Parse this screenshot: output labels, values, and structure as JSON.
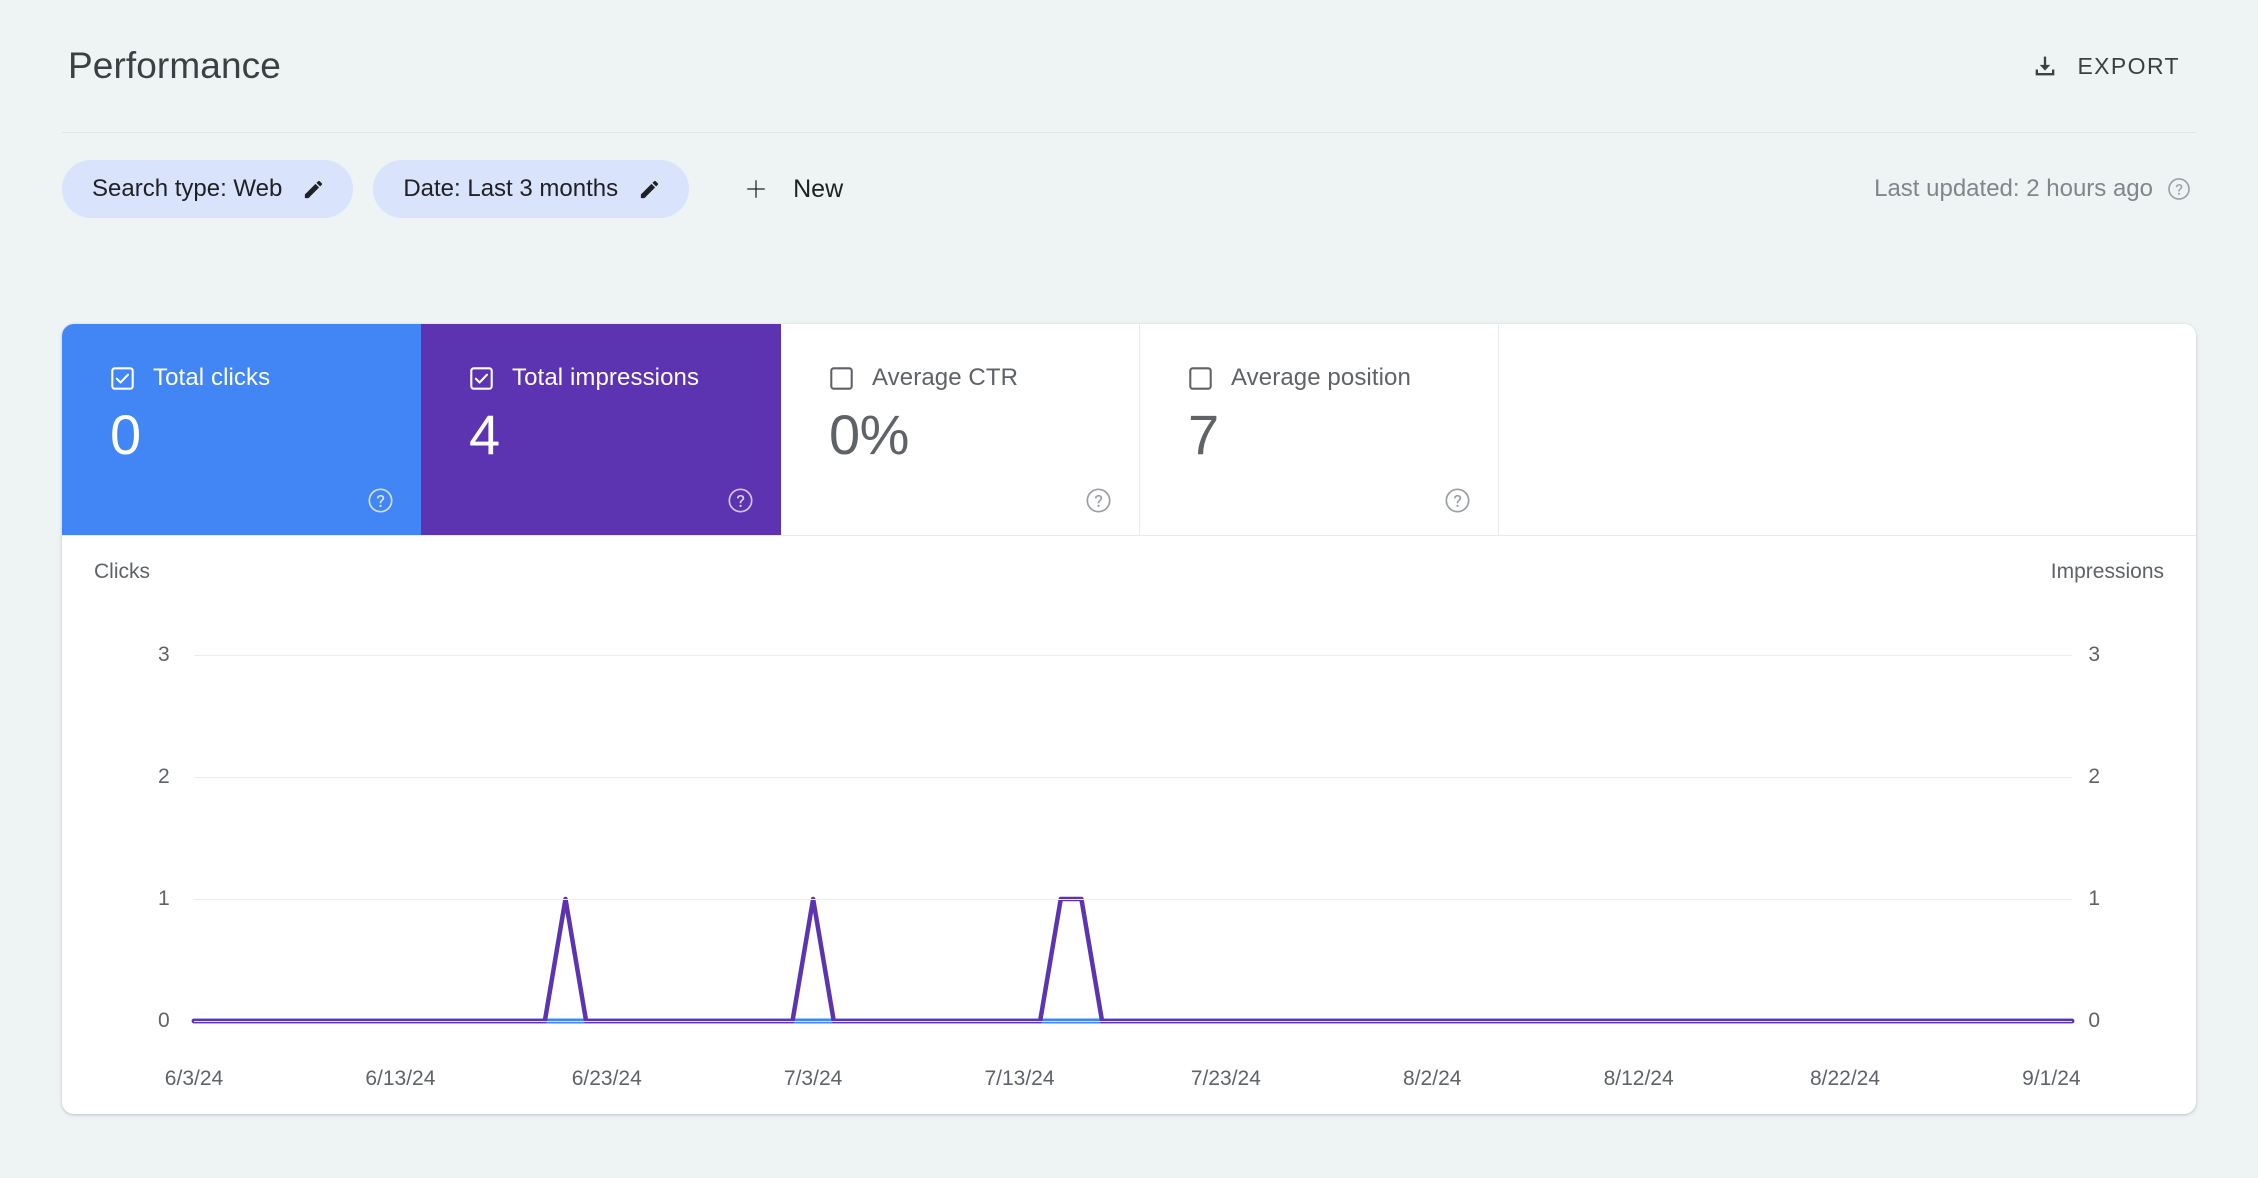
{
  "header": {
    "title": "Performance",
    "export_label": "EXPORT",
    "export_icon": "download-icon"
  },
  "filters": {
    "chips": [
      {
        "label": "Search type: Web",
        "icon": "pencil-icon"
      },
      {
        "label": "Date: Last 3 months",
        "icon": "pencil-icon"
      }
    ],
    "new_label": "New",
    "new_icon": "plus-icon",
    "last_updated": "Last updated: 2 hours ago",
    "last_updated_icon": "help-icon"
  },
  "metrics": [
    {
      "label": "Total clicks",
      "value": "0",
      "checked": true,
      "color": "#4285f4",
      "help_icon": "help-icon"
    },
    {
      "label": "Total impressions",
      "value": "4",
      "checked": true,
      "color": "#5c34b2",
      "help_icon": "help-icon"
    },
    {
      "label": "Average CTR",
      "value": "0%",
      "checked": false,
      "color": "#ffffff",
      "help_icon": "help-icon"
    },
    {
      "label": "Average position",
      "value": "7",
      "checked": false,
      "color": "#ffffff",
      "help_icon": "help-icon"
    }
  ],
  "chart_data": {
    "type": "line",
    "title": "",
    "xlabel": "",
    "ylabel": "Clicks",
    "y2label": "Impressions",
    "ylim": [
      0,
      3
    ],
    "y2lim": [
      0,
      3
    ],
    "yticks": [
      "0",
      "1",
      "2",
      "3"
    ],
    "y2ticks": [
      "0",
      "1",
      "2",
      "3"
    ],
    "grid": true,
    "legend": "none",
    "xticklabels": [
      "6/3/24",
      "6/13/24",
      "6/23/24",
      "7/3/24",
      "7/13/24",
      "7/23/24",
      "8/2/24",
      "8/12/24",
      "8/22/24",
      "9/1/24"
    ],
    "x_start": "6/3/24",
    "x_end": "9/5/24",
    "series": [
      {
        "name": "Clicks",
        "color": "#4285f4",
        "axis": "left",
        "total": 0,
        "points": [
          {
            "x": 0,
            "y": 0
          },
          {
            "x": 91,
            "y": 0
          }
        ]
      },
      {
        "name": "Impressions",
        "color": "#5c34b2",
        "axis": "right",
        "total": 4,
        "points": [
          {
            "x": 0,
            "y": 0
          },
          {
            "x": 17,
            "y": 0
          },
          {
            "x": 18,
            "y": 1
          },
          {
            "x": 19,
            "y": 0
          },
          {
            "x": 29,
            "y": 0
          },
          {
            "x": 30,
            "y": 1
          },
          {
            "x": 31,
            "y": 0
          },
          {
            "x": 41,
            "y": 0
          },
          {
            "x": 42,
            "y": 1
          },
          {
            "x": 43,
            "y": 1
          },
          {
            "x": 44,
            "y": 0
          },
          {
            "x": 91,
            "y": 0
          }
        ]
      }
    ]
  }
}
